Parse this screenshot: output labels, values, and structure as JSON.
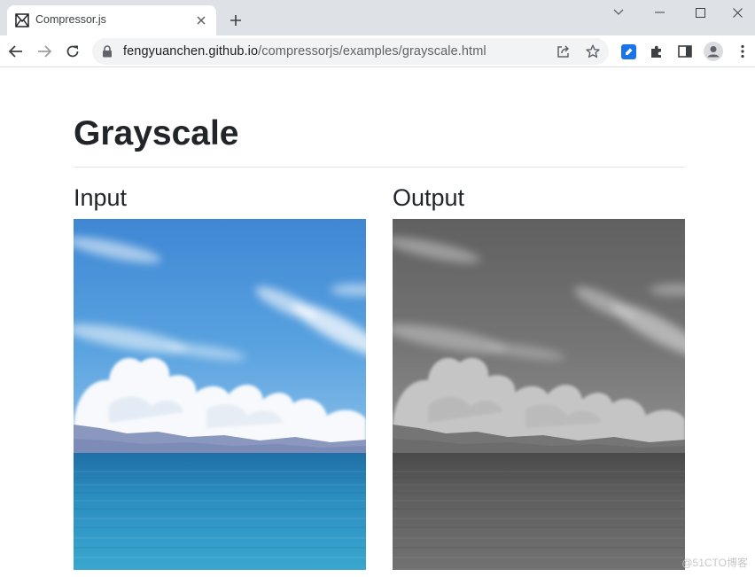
{
  "browser": {
    "tab_title": "Compressor.js",
    "url_host": "fengyuanchen.github.io",
    "url_path": "/compressorjs/examples/grayscale.html",
    "accent_color": "#1a73e8"
  },
  "page": {
    "title": "Grayscale",
    "input_heading": "Input",
    "output_heading": "Output",
    "input_image_alt": "Input",
    "output_image_alt": "Output"
  },
  "watermark": "@51CTO博客"
}
